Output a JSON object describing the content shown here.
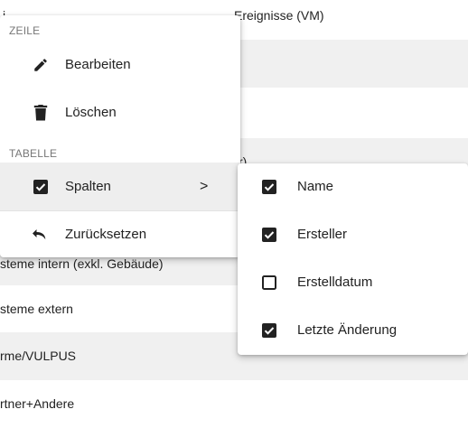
{
  "background_rows": [
    {
      "text": "Ereignisse (VM)",
      "prefix": "i"
    },
    {
      "text": "",
      "prefix": ""
    },
    {
      "text": "",
      "prefix": ""
    },
    {
      "text": "r)",
      "prefix": ""
    },
    {
      "text": "",
      "prefix": ""
    },
    {
      "text": "steme intern (exkl. Gebäude)",
      "prefix": ""
    },
    {
      "text": "steme extern",
      "prefix": ""
    },
    {
      "text": "rme/VULPUS",
      "prefix": ""
    },
    {
      "text": "rtner+Andere",
      "prefix": ""
    }
  ],
  "context_menu": {
    "section_row": "ZEILE",
    "edit_label": "Bearbeiten",
    "delete_label": "Löschen",
    "section_table": "TABELLE",
    "columns_label": "Spalten",
    "columns_arrow": ">",
    "reset_label": "Zurücksetzen"
  },
  "columns_submenu": {
    "items": [
      {
        "label": "Name",
        "checked": true
      },
      {
        "label": "Ersteller",
        "checked": true
      },
      {
        "label": "Erstelldatum",
        "checked": false
      },
      {
        "label": "Letzte Änderung",
        "checked": true
      }
    ]
  },
  "colors": {
    "row_shade": "#f0f0f0",
    "menu_bg": "#ffffff",
    "active_item": "#eeeeee",
    "icon": "#222222",
    "accent_edge": "#e07a1f"
  }
}
